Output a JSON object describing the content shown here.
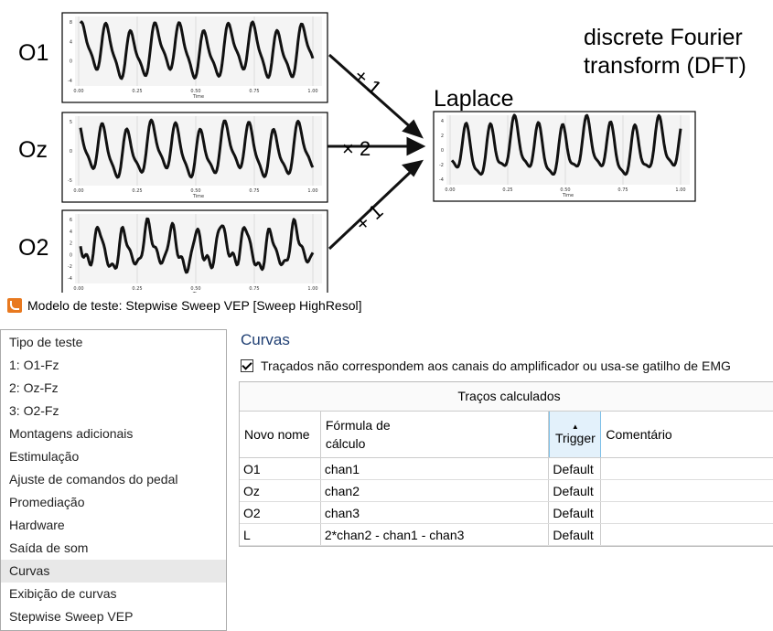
{
  "figure": {
    "dft_text": [
      "discrete Fourier",
      "transform (DFT)"
    ],
    "laplace_label": "Laplace",
    "channels": [
      {
        "label": "O1",
        "weight": "+ 1"
      },
      {
        "label": "Oz",
        "weight": "× 2"
      },
      {
        "label": "O2",
        "weight": "+ 1"
      }
    ],
    "x_ticks": [
      "0.00",
      "0.25",
      "0.50",
      "0.75",
      "1.00"
    ],
    "x_label": "Time",
    "y_ticks": {
      "O1": [
        "8",
        "4",
        "0",
        "-4"
      ],
      "Oz": [
        "5",
        "0",
        "-5"
      ],
      "O2": [
        "6",
        "4",
        "2",
        "0",
        "-2",
        "-4"
      ],
      "Laplace": [
        "4",
        "2",
        "0",
        "-2",
        "-4"
      ]
    }
  },
  "window": {
    "title": "Modelo de teste: Stepwise Sweep VEP [Sweep HighResol]"
  },
  "sidebar": {
    "items": [
      "Tipo de teste",
      "1: O1-Fz",
      "2: Oz-Fz",
      "3: O2-Fz",
      "Montagens adicionais",
      "Estimulação",
      "Ajuste de comandos do pedal",
      "Promediação",
      "Hardware",
      "Saída de som",
      "Curvas",
      "Exibição de curvas",
      "Stepwise Sweep VEP"
    ],
    "selected": "Curvas"
  },
  "main": {
    "title": "Curvas",
    "checkbox_label": "Traçados não correspondem aos canais do amplificador ou usa-se gatilho de EMG",
    "checkbox_checked": true,
    "table": {
      "group_header": "Traços calculados",
      "columns": [
        "Novo nome",
        "Fórmula de cálculo",
        "Trigger",
        "Comentário"
      ],
      "rows": [
        [
          "O1",
          "chan1",
          "Default",
          ""
        ],
        [
          "Oz",
          "chan2",
          "Default",
          ""
        ],
        [
          "O2",
          "chan3",
          "Default",
          ""
        ],
        [
          "L",
          "2*chan2 - chan1 - chan3",
          "Default",
          ""
        ]
      ]
    }
  }
}
